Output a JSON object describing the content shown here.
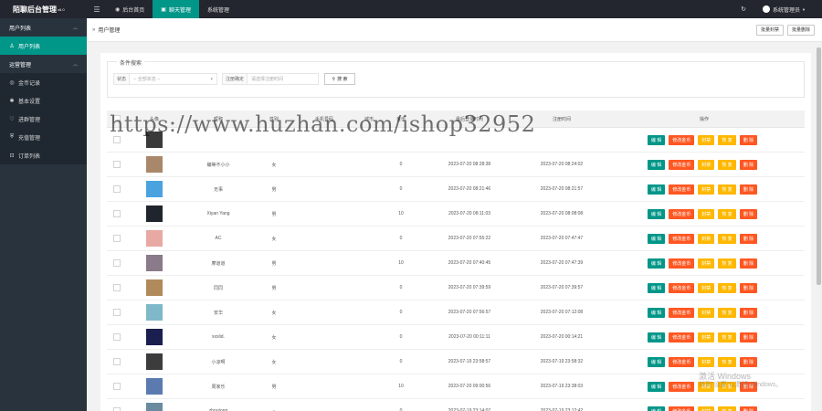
{
  "brand": {
    "name": "陌聊后台管理",
    "version": "v6.0"
  },
  "topnav": [
    {
      "label": "后台首页",
      "icon": "dashboard-icon"
    },
    {
      "label": "聊天管理",
      "icon": "chat-icon"
    },
    {
      "label": "系统管理",
      "icon": ""
    }
  ],
  "topright": {
    "user": "系统管理员"
  },
  "sidebar": {
    "group1": "用户列表",
    "group1_item": "用户列表",
    "group2": "运营管理",
    "items": [
      {
        "label": "金币记录",
        "icon": "coin-icon"
      },
      {
        "label": "基本设置",
        "icon": "settings-icon"
      },
      {
        "label": "进群管理",
        "icon": "heart-icon"
      },
      {
        "label": "充值管理",
        "icon": "shield-icon"
      },
      {
        "label": "订单列表",
        "icon": "cart-icon"
      }
    ]
  },
  "crumb": {
    "title": "用户管理",
    "btn1": "批量封禁",
    "btn2": "批量删除"
  },
  "filter": {
    "legend": "条件搜索",
    "status_label": "状态",
    "status_placeholder": "-- 全部状态 --",
    "time_label": "注册确定",
    "time_placeholder": "请选择注册时间",
    "search": "搜 索"
  },
  "table": {
    "headers": [
      "头像",
      "昵称",
      "性别",
      "手机号码",
      "城市",
      "金币",
      "最后登录时间",
      "注册时间",
      "操作"
    ],
    "ops": {
      "edit": "编 辑",
      "coin": "修改金币",
      "ban": "封禁",
      "rec": "恢 复",
      "del": "删 除"
    },
    "rows": [
      {
        "nick": "",
        "sex": "",
        "coin": "",
        "last": "",
        "reg": "",
        "color": "#3a3a3a"
      },
      {
        "nick": "编等不小小",
        "sex": "女",
        "coin": "0",
        "last": "2023-07-20 08:28:38",
        "reg": "2023-07-20 08:24:02",
        "color": "#a9876a"
      },
      {
        "nick": "无事",
        "sex": "男",
        "coin": "0",
        "last": "2023-07-20 08:21:46",
        "reg": "2023-07-20 08:21:57",
        "color": "#4aa3df"
      },
      {
        "nick": "Xiyan Yang",
        "sex": "男",
        "coin": "10",
        "last": "2023-07-20 08:11:03",
        "reg": "2023-07-20 08:08:08",
        "color": "#20242d"
      },
      {
        "nick": "AC",
        "sex": "女",
        "coin": "0",
        "last": "2023-07-20 07:55:22",
        "reg": "2023-07-20 07:47:47",
        "color": "#e8a9a2"
      },
      {
        "nick": "摩道道",
        "sex": "男",
        "coin": "10",
        "last": "2023-07-20 07:40:45",
        "reg": "2023-07-20 07:47:39",
        "color": "#8a7a8a"
      },
      {
        "nick": "同同",
        "sex": "男",
        "coin": "0",
        "last": "2023-07-20 07:39:59",
        "reg": "2023-07-20 07:39:57",
        "color": "#b08a5a"
      },
      {
        "nick": "安华",
        "sex": "女",
        "coin": "0",
        "last": "2023-07-20 07:56:57",
        "reg": "2023-07-20 07:12:08",
        "color": "#7fb8c8"
      },
      {
        "nick": "xxxlid.",
        "sex": "女",
        "coin": "0",
        "last": "2023-07-20 00:11:11",
        "reg": "2023-07-20 00:14:21",
        "color": "#1a1f4f"
      },
      {
        "nick": "小凉啊",
        "sex": "女",
        "coin": "0",
        "last": "2023-07-19 23:58:57",
        "reg": "2023-07-19 23:58:32",
        "color": "#3c3c3c"
      },
      {
        "nick": "周家乐",
        "sex": "男",
        "coin": "10",
        "last": "2023-07-20 09:00:56",
        "reg": "2023-07-19 23:38:03",
        "color": "#5a7ab0"
      },
      {
        "nick": "zhoutong",
        "sex": "-",
        "coin": "0",
        "last": "2023-07-19 23:14:07",
        "reg": "2023-07-19 23:12:42",
        "color": "#6a8aa0"
      }
    ]
  },
  "watermark": "https://www.huzhan.com/ishop32952",
  "activate": {
    "line1": "激活 Windows",
    "line2": "转到\"设置\"以激活 Windows。"
  }
}
